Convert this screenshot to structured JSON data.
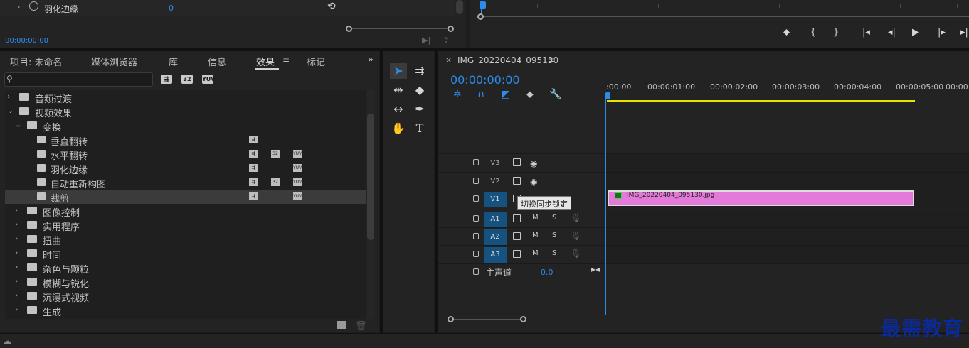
{
  "effect_controls": {
    "row_label": "羽化边缘",
    "row_value": "0",
    "timecode": "00:00:00:00"
  },
  "project_panel": {
    "tabs": [
      "项目: 未命名",
      "媒体浏览器",
      "库",
      "信息",
      "效果",
      "标记"
    ],
    "active_tab": "效果",
    "badges": [
      "32",
      "YUV"
    ],
    "tree": [
      {
        "label": "音频过渡",
        "type": "folder",
        "expanded": false
      },
      {
        "label": "视频效果",
        "type": "folder",
        "expanded": true
      },
      {
        "label": "变换",
        "type": "folder",
        "expanded": true
      },
      {
        "label": "垂直翻转",
        "type": "effect"
      },
      {
        "label": "水平翻转",
        "type": "effect"
      },
      {
        "label": "羽化边缘",
        "type": "effect"
      },
      {
        "label": "自动重新构图",
        "type": "effect"
      },
      {
        "label": "裁剪",
        "type": "effect",
        "selected": true
      },
      {
        "label": "图像控制",
        "type": "folder",
        "expanded": false
      },
      {
        "label": "实用程序",
        "type": "folder",
        "expanded": false
      },
      {
        "label": "扭曲",
        "type": "folder",
        "expanded": false
      },
      {
        "label": "时间",
        "type": "folder",
        "expanded": false
      },
      {
        "label": "杂色与颗粒",
        "type": "folder",
        "expanded": false
      },
      {
        "label": "模糊与锐化",
        "type": "folder",
        "expanded": false
      },
      {
        "label": "沉浸式视频",
        "type": "folder",
        "expanded": false
      },
      {
        "label": "生成",
        "type": "folder",
        "expanded": false
      }
    ]
  },
  "timeline": {
    "sequence_name": "IMG_20220404_095130",
    "timecode": "00:00:00:00",
    "ruler_labels": [
      ":00:00",
      "00:00:01:00",
      "00:00:02:00",
      "00:00:03:00",
      "00:00:04:00",
      "00:00:05:00",
      "00:00"
    ],
    "video_tracks": [
      "V3",
      "V2",
      "V1"
    ],
    "audio_tracks": [
      "A1",
      "A2",
      "A3"
    ],
    "mute_label": "M",
    "solo_label": "S",
    "master_label": "主声道",
    "master_value": "0.0",
    "clip_name": "IMG_20220404_095130.jpg",
    "tooltip": "切换同步锁定"
  },
  "watermark": "最需教育",
  "colors": {
    "accent": "#2d8ceb",
    "clip": "#e379d8",
    "work_area": "#e8e300",
    "track_target": "#16527f"
  }
}
